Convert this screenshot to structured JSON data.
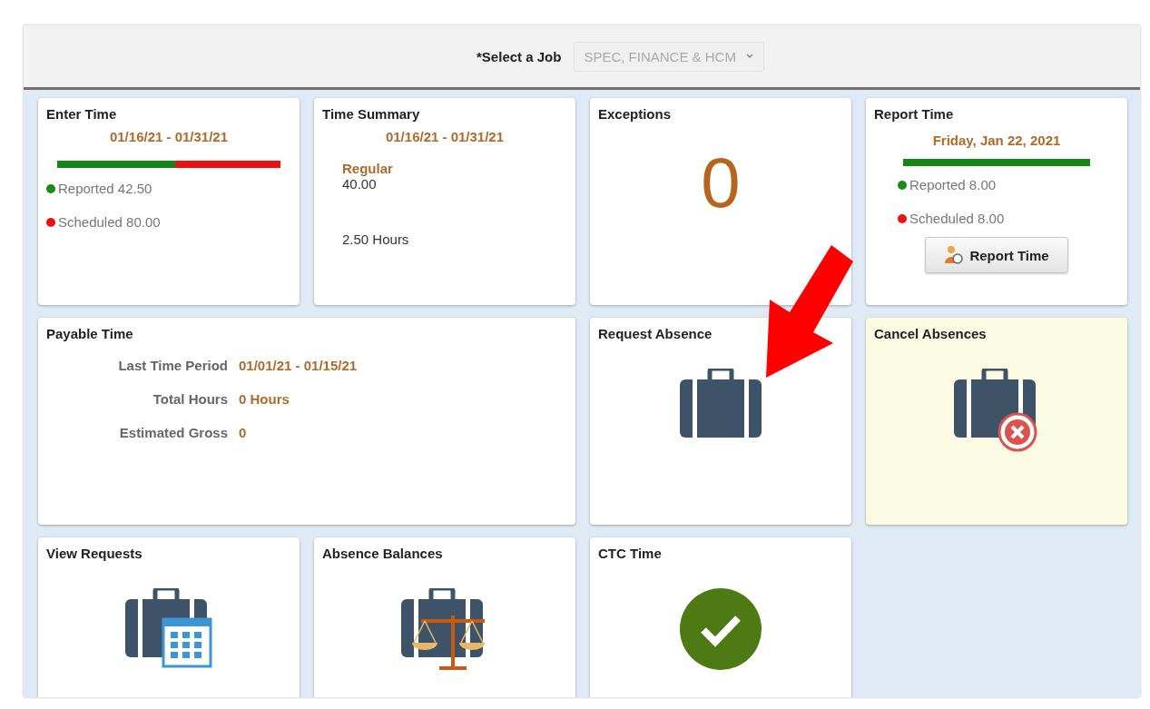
{
  "header": {
    "label": "*Select a Job",
    "select": {
      "value": "SPEC, FINANCE & HCM",
      "disabled": true
    }
  },
  "tiles": [
    {
      "kind": "progress",
      "title": "Enter Time",
      "period": "01/16/21 - 01/31/21",
      "level": 0.53,
      "legend": [
        {
          "label": "Reported 42.50",
          "color": "#1a8a1a"
        },
        {
          "label": "Scheduled 80.00",
          "color": "#f01010"
        }
      ]
    },
    {
      "kind": "summary",
      "title": "Time Summary",
      "period": "01/16/21 - 01/31/21",
      "category": "Regular",
      "amount": "40.00",
      "hours": "2.50 Hours"
    },
    {
      "kind": "count",
      "title": "Exceptions",
      "count": "0"
    },
    {
      "kind": "report",
      "title": "Report Time",
      "date": "Friday, Jan 22, 2021",
      "level": 1,
      "legend": [
        {
          "label": "Reported 8.00",
          "color": "#1a8a1a"
        },
        {
          "label": "Scheduled 8.00",
          "color": "#f01010"
        }
      ],
      "button": "Report Time"
    },
    {
      "kind": "payable",
      "title": "Payable Time",
      "rows": [
        {
          "label": "Last Time Period",
          "value": "01/01/21 - 01/15/21"
        },
        {
          "label": "Total Hours",
          "value": "0 Hours"
        },
        {
          "label": "Estimated Gross",
          "value": "0"
        }
      ]
    },
    {
      "kind": "briefcase",
      "title": "Request Absence",
      "highlighted": false
    },
    {
      "kind": "briefcase-cancel",
      "title": "Cancel Absences",
      "highlighted": true
    },
    {
      "kind": "briefcase-calendar",
      "title": "View Requests",
      "highlighted": false
    },
    {
      "kind": "briefcase-scale",
      "title": "Absence Balances",
      "highlighted": false
    },
    {
      "kind": "check",
      "title": "CTC Time",
      "highlighted": false
    }
  ]
}
